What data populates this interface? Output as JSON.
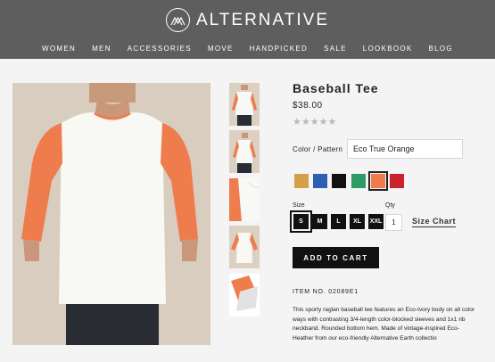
{
  "brand": {
    "name": "ALTERNATIVE",
    "logo_icon": "mountain-monogram-icon"
  },
  "nav": [
    "WOMEN",
    "MEN",
    "ACCESSORIES",
    "MOVE",
    "HANDPICKED",
    "SALE",
    "LOOKBOOK",
    "BLOG"
  ],
  "product": {
    "title": "Baseball Tee",
    "price": "$38.00",
    "rating_stars": "★★★★★",
    "rating": {
      "value": 0,
      "max": 5
    },
    "color_label": "Color / Pattern",
    "color_value": "Eco True Orange",
    "swatches": [
      {
        "name": "gold",
        "hex": "#d4a14a",
        "selected": false
      },
      {
        "name": "blue",
        "hex": "#2f5fb5",
        "selected": false
      },
      {
        "name": "black",
        "hex": "#111111",
        "selected": false
      },
      {
        "name": "green",
        "hex": "#2e9a68",
        "selected": false
      },
      {
        "name": "orange",
        "hex": "#ef7a4c",
        "selected": true
      },
      {
        "name": "red",
        "hex": "#cc2230",
        "selected": false
      }
    ],
    "size_label": "Size",
    "sizes": [
      "S",
      "M",
      "L",
      "XL",
      "XXL"
    ],
    "selected_size": "S",
    "qty_label": "Qty",
    "qty_value": "1",
    "size_chart_label": "Size Chart",
    "add_to_cart_label": "ADD TO CART",
    "item_number": "ITEM NO. 02089E1",
    "description": "This sporty raglan baseball tee features an Eco-Ivory body on all color ways with contrasting 3/4-length color-blocked sleeves and 1x1 rib neckband. Rounded bottom hem. Made of vintage-inspired Eco-Heather from our eco-friendly Alternative Earth collectio"
  },
  "colors": {
    "header_bg": "#5f5e5f",
    "page_bg": "#f4f4f4",
    "sleeve": "#ef7d4f",
    "button": "#111111"
  }
}
